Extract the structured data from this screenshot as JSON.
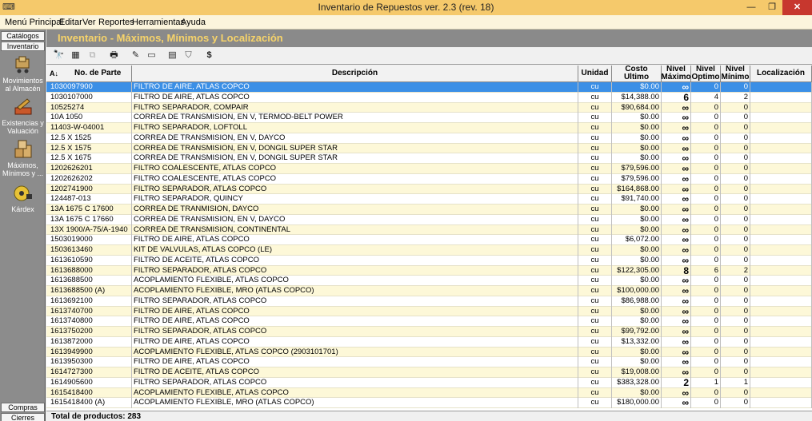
{
  "window": {
    "title": "Inventario de Repuestos ver. 2.3  (rev. 18)",
    "min_glyph": "—",
    "max_glyph": "❐",
    "close_glyph": "✕",
    "app_icon": "keyboard-icon"
  },
  "menu": [
    "Menú Principal",
    "Editar",
    "Ver",
    "Reportes",
    "Herramientas",
    "Ayuda"
  ],
  "sidebar": {
    "catalogos": "Catálogos",
    "inventario": "Inventario",
    "items": [
      {
        "label": "Movimientos al Almacén",
        "icon": "cart-icon"
      },
      {
        "label": "Existencias y Valuación",
        "icon": "tools-icon"
      },
      {
        "label": "Máximos, Mínimos y ...",
        "icon": "boxes-icon"
      },
      {
        "label": "Kárdex",
        "icon": "tape-icon"
      }
    ],
    "compras": "Compras",
    "cierres": "Cierres"
  },
  "header": {
    "title": "Inventario - Máximos, Mínimos y Localización"
  },
  "toolbar": {
    "icons": [
      "binoculars-icon",
      "calculator-icon",
      "copy-icon",
      "print-icon",
      "edit-pen-icon",
      "eraser-icon",
      "export-icon",
      "filter-icon",
      "dollar-icon"
    ],
    "glyphs": [
      "🔭",
      "▦",
      "⧉",
      "🖶",
      "✎",
      "▭",
      "▤",
      "⛉",
      "$"
    ]
  },
  "grid": {
    "sort_glyph": "A↓",
    "columns": [
      "No. de Parte",
      "Descripción",
      "Unidad",
      "Costo Ultimo",
      "Nivel Máximo",
      "Nivel Optimo",
      "Nivel Mínimo",
      "Localización"
    ],
    "rows": [
      [
        "1030097900",
        "FILTRO DE AIRE, ATLAS COPCO",
        "cu",
        "$0.00",
        "∞",
        "0",
        "0",
        ""
      ],
      [
        "1030107000",
        "FILTRO DE AIRE, ATLAS COPCO",
        "cu",
        "$14,388.00",
        "6",
        "4",
        "2",
        ""
      ],
      [
        "10525274",
        "FILTRO SEPARADOR, COMPAIR",
        "cu",
        "$90,684.00",
        "∞",
        "0",
        "0",
        ""
      ],
      [
        "10A 1050",
        "CORREA DE TRANSMISION, EN V, TERMOD-BELT POWER",
        "cu",
        "$0.00",
        "∞",
        "0",
        "0",
        ""
      ],
      [
        "11403-W-04001",
        "FILTRO SEPARADOR, LOFTOLL",
        "cu",
        "$0.00",
        "∞",
        "0",
        "0",
        ""
      ],
      [
        "12.5 X 1525",
        "CORREA DE TRANSMISION, EN V, DAYCO",
        "cu",
        "$0.00",
        "∞",
        "0",
        "0",
        ""
      ],
      [
        "12.5 X 1575",
        "CORREA DE TRANSMISION, EN V, DONGIL SUPER STAR",
        "cu",
        "$0.00",
        "∞",
        "0",
        "0",
        ""
      ],
      [
        "12.5 X 1675",
        "CORREA DE TRANSMISION, EN V, DONGIL SUPER STAR",
        "cu",
        "$0.00",
        "∞",
        "0",
        "0",
        ""
      ],
      [
        "1202626201",
        "FILTRO COALESCENTE, ATLAS COPCO",
        "cu",
        "$79,596.00",
        "∞",
        "0",
        "0",
        ""
      ],
      [
        "1202626202",
        "FILTRO COALESCENTE, ATLAS COPCO",
        "cu",
        "$79,596.00",
        "∞",
        "0",
        "0",
        ""
      ],
      [
        "1202741900",
        "FILTRO SEPARADOR, ATLAS COPCO",
        "cu",
        "$164,868.00",
        "∞",
        "0",
        "0",
        ""
      ],
      [
        "124487-013",
        "FILTRO SEPARADOR, QUINCY",
        "cu",
        "$91,740.00",
        "∞",
        "0",
        "0",
        ""
      ],
      [
        "13A 1675 C 17600",
        "CORREA DE TRANMISION, DAYCO",
        "cu",
        "$0.00",
        "∞",
        "0",
        "0",
        ""
      ],
      [
        "13A 1675 C 17660",
        "CORREA DE TRANSMISION, EN V, DAYCO",
        "cu",
        "$0.00",
        "∞",
        "0",
        "0",
        ""
      ],
      [
        "13X 1900/A-75/A-1940",
        "CORREA DE TRANSMISION, CONTINENTAL",
        "cu",
        "$0.00",
        "∞",
        "0",
        "0",
        ""
      ],
      [
        "1503019000",
        "FILTRO DE AIRE, ATLAS COPCO",
        "cu",
        "$6,072.00",
        "∞",
        "0",
        "0",
        ""
      ],
      [
        "1503613460",
        "KIT DE VALVULAS, ATLAS COPCO (LE)",
        "cu",
        "$0.00",
        "∞",
        "0",
        "0",
        ""
      ],
      [
        "1613610590",
        "FILTRO DE ACEITE, ATLAS COPCO",
        "cu",
        "$0.00",
        "∞",
        "0",
        "0",
        ""
      ],
      [
        "1613688000",
        "FILTRO SEPARADOR, ATLAS COPCO",
        "cu",
        "$122,305.00",
        "8",
        "6",
        "2",
        ""
      ],
      [
        "1613688500",
        "ACOPLAMIENTO FLEXIBLE, ATLAS COPCO",
        "cu",
        "$0.00",
        "∞",
        "0",
        "0",
        ""
      ],
      [
        "1613688500 (A)",
        "ACOPLAMIENTO FLEXIBLE, MRO (ATLAS COPCO)",
        "cu",
        "$100,000.00",
        "∞",
        "0",
        "0",
        ""
      ],
      [
        "1613692100",
        "FILTRO SEPARADOR, ATLAS COPCO",
        "cu",
        "$86,988.00",
        "∞",
        "0",
        "0",
        ""
      ],
      [
        "1613740700",
        "FILTRO DE AIRE, ATLAS COPCO",
        "cu",
        "$0.00",
        "∞",
        "0",
        "0",
        ""
      ],
      [
        "1613740800",
        "FILTRO DE AIRE, ATLAS COPCO",
        "cu",
        "$0.00",
        "∞",
        "0",
        "0",
        ""
      ],
      [
        "1613750200",
        "FILTRO SEPARADOR, ATLAS COPCO",
        "cu",
        "$99,792.00",
        "∞",
        "0",
        "0",
        ""
      ],
      [
        "1613872000",
        "FILTRO DE AIRE, ATLAS COPCO",
        "cu",
        "$13,332.00",
        "∞",
        "0",
        "0",
        ""
      ],
      [
        "1613949900",
        "ACOPLAMIENTO FLEXIBLE, ATLAS COPCO (2903101701)",
        "cu",
        "$0.00",
        "∞",
        "0",
        "0",
        ""
      ],
      [
        "1613950300",
        "FILTRO DE AIRE, ATLAS COPCO",
        "cu",
        "$0.00",
        "∞",
        "0",
        "0",
        ""
      ],
      [
        "1614727300",
        "FILTRO DE ACEITE, ATLAS COPCO",
        "cu",
        "$19,008.00",
        "∞",
        "0",
        "0",
        ""
      ],
      [
        "1614905600",
        "FILTRO SEPARADOR, ATLAS COPCO",
        "cu",
        "$383,328.00",
        "2",
        "1",
        "1",
        ""
      ],
      [
        "1615418400",
        "ACOPLAMIENTO FLEXIBLE, ATLAS COPCO",
        "cu",
        "$0.00",
        "∞",
        "0",
        "0",
        ""
      ],
      [
        "1615418400 (A)",
        "ACOPLAMIENTO FLEXIBLE, MRO (ATLAS COPCO)",
        "cu",
        "$180,000.00",
        "∞",
        "0",
        "0",
        ""
      ]
    ]
  },
  "footer": {
    "total": "Total de productos: 283"
  }
}
